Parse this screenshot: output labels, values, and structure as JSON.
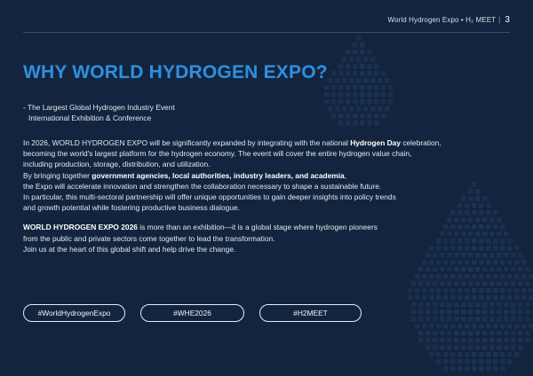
{
  "header": {
    "text": "World Hydrogen Expo • H₂ MEET",
    "separator": "|",
    "page_number": "3"
  },
  "title": "WHY WORLD HYDROGEN EXPO?",
  "subhead": {
    "line1": "- The Largest Global Hydrogen Industry Event",
    "line2": "International Exhibition & Conference"
  },
  "paragraph1": {
    "l1_a": "In 2026, WORLD HYDROGEN EXPO will be significantly expanded by integrating with the national ",
    "l1_b": "Hydrogen Day",
    "l1_c": " celebration,",
    "l2": "becoming the world's largest platform for the hydrogen economy. The event will cover the entire hydrogen value chain,",
    "l3": "including production, storage, distribution, and utilization.",
    "l4_a": "By bringing together ",
    "l4_b": "government agencies, local authorities, industry leaders, and academia",
    "l4_c": ",",
    "l5": "the Expo will accelerate innovation and strengthen the collaboration necessary to shape a sustainable future.",
    "l6": "In particular, this multi-sectoral partnership will offer unique opportunities to gain deeper insights into policy trends",
    "l7": "and growth potential while fostering productive business dialogue."
  },
  "paragraph2": {
    "l1_a": "WORLD HYDROGEN EXPO 2026",
    "l1_b": " is more than an exhibition—it is a global stage where hydrogen pioneers",
    "l2": "from the public and private sectors come together to lead the transformation.",
    "l3": "Join us at the heart of this global shift and help drive the change."
  },
  "tags": [
    "#WorldHydrogenExpo",
    "#WHE2026",
    "#H2MEET"
  ],
  "colors": {
    "background": "#13253e",
    "title": "#2f8fe0",
    "pattern": "#1d3556"
  }
}
